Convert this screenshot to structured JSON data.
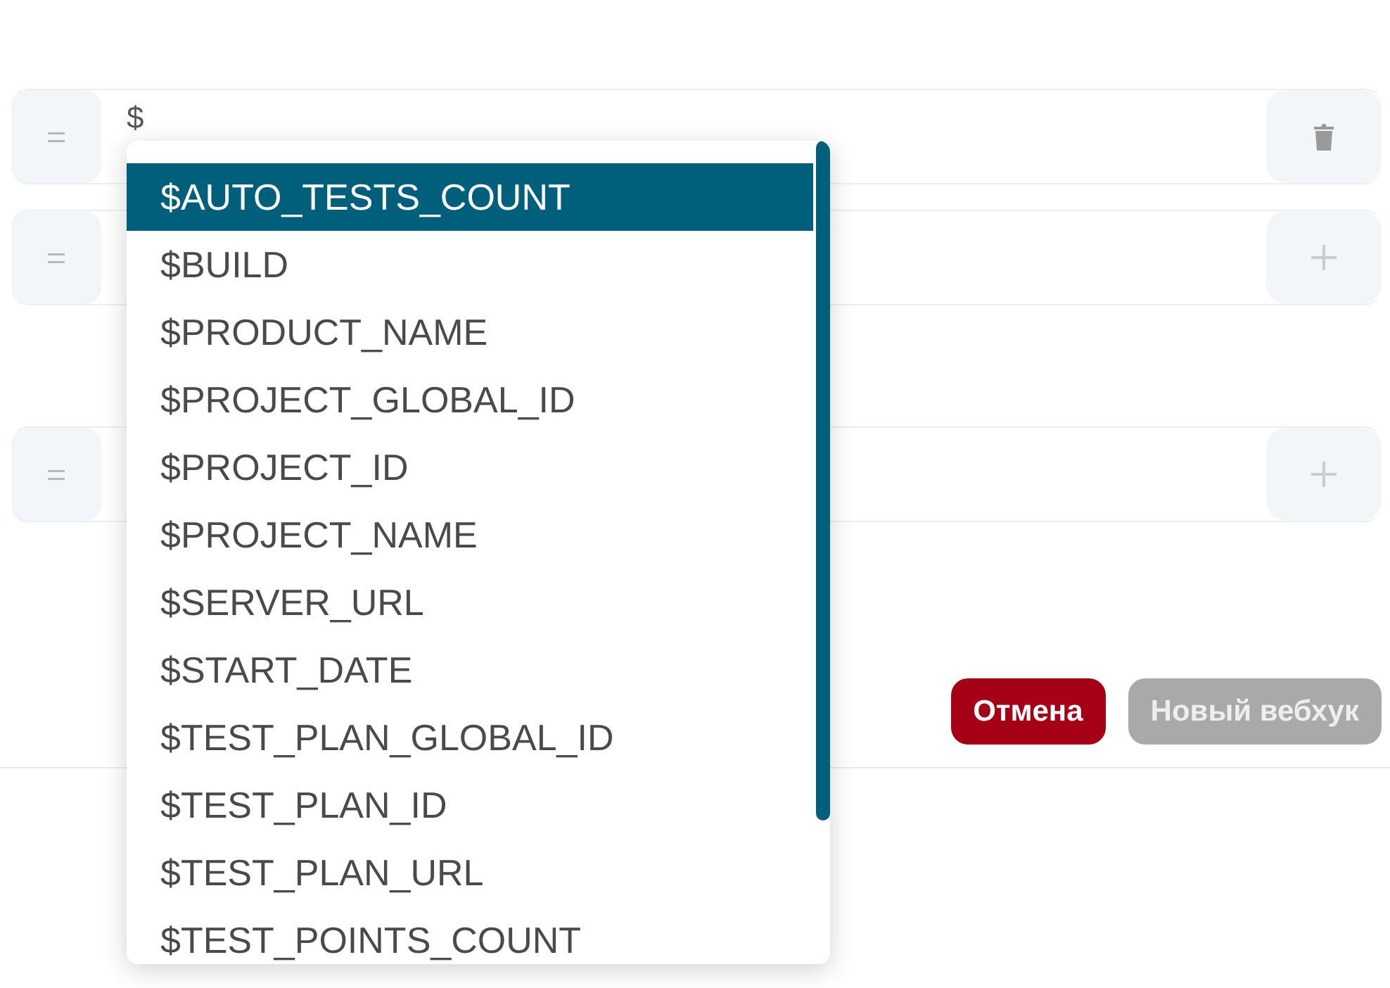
{
  "rows": [
    {
      "value": "$",
      "kind": "delete"
    },
    {
      "kind": "add"
    },
    {
      "kind": "add"
    }
  ],
  "suggestions": [
    {
      "label": "$AUTO_TESTS_COUNT",
      "selected": true
    },
    {
      "label": "$BUILD",
      "selected": false
    },
    {
      "label": "$PRODUCT_NAME",
      "selected": false
    },
    {
      "label": "$PROJECT_GLOBAL_ID",
      "selected": false
    },
    {
      "label": "$PROJECT_ID",
      "selected": false
    },
    {
      "label": "$PROJECT_NAME",
      "selected": false
    },
    {
      "label": "$SERVER_URL",
      "selected": false
    },
    {
      "label": "$START_DATE",
      "selected": false
    },
    {
      "label": "$TEST_PLAN_GLOBAL_ID",
      "selected": false
    },
    {
      "label": "$TEST_PLAN_ID",
      "selected": false
    },
    {
      "label": "$TEST_PLAN_URL",
      "selected": false
    },
    {
      "label": "$TEST_POINTS_COUNT",
      "selected": false
    }
  ],
  "buttons": [
    {
      "label": "Отмена",
      "kind": "danger",
      "disabled": false
    },
    {
      "label": "Новый вебхук",
      "kind": "primary",
      "disabled": true
    }
  ]
}
